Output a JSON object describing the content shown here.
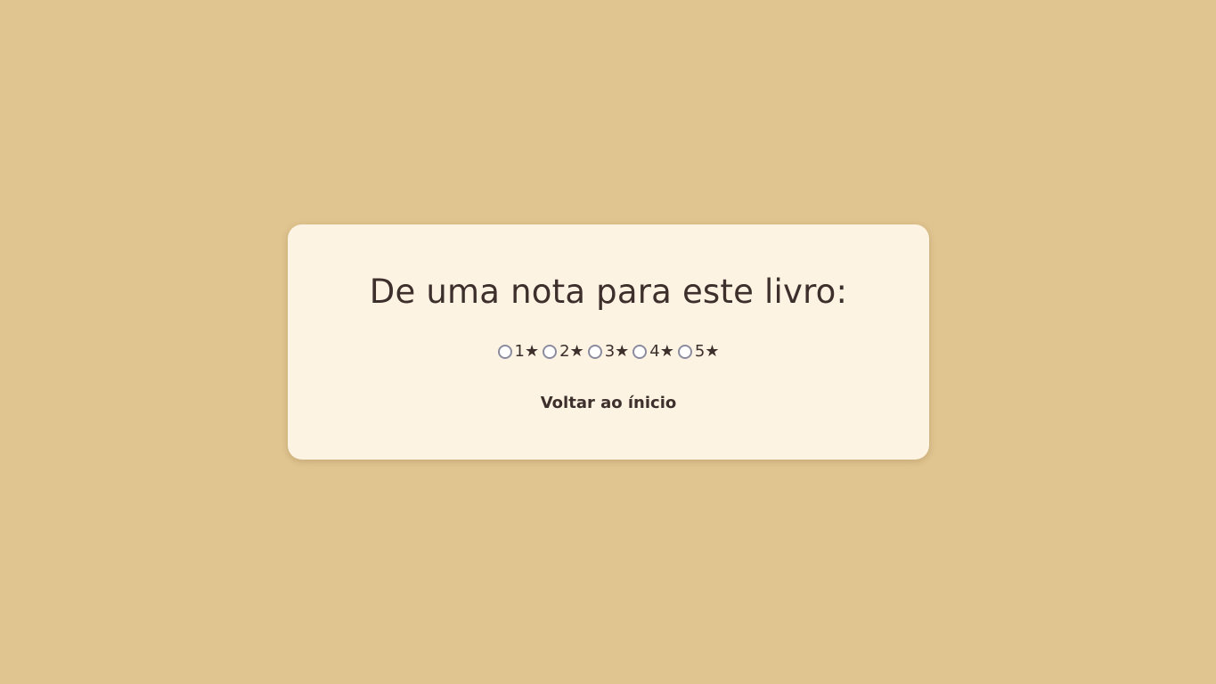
{
  "colors": {
    "background": "#e1c590",
    "card": "#fdf3e3",
    "text": "#3d2f2b",
    "radio_border": "#8c8ca0"
  },
  "card": {
    "title": "De uma nota para este livro:",
    "rating_options": [
      {
        "label": "1★",
        "selected": false
      },
      {
        "label": "2★",
        "selected": false
      },
      {
        "label": "3★",
        "selected": false
      },
      {
        "label": "4★",
        "selected": false
      },
      {
        "label": "5★",
        "selected": false
      }
    ],
    "back_link_label": "Voltar ao ínicio"
  }
}
